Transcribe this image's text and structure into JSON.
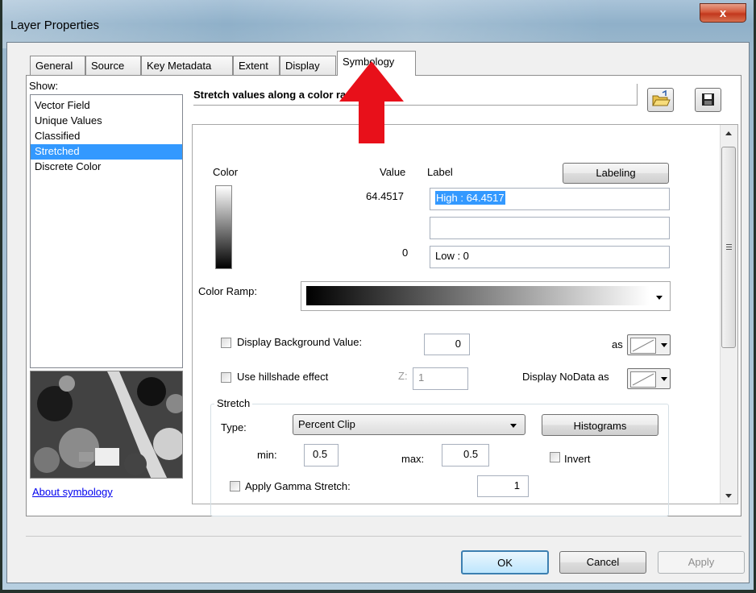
{
  "window": {
    "title": "Layer Properties",
    "close_glyph": "x"
  },
  "tabs": [
    {
      "label": "General"
    },
    {
      "label": "Source"
    },
    {
      "label": "Key Metadata"
    },
    {
      "label": "Extent"
    },
    {
      "label": "Display"
    },
    {
      "label": "Symbology"
    }
  ],
  "active_tab": "Symbology",
  "show": {
    "label": "Show:",
    "items": [
      "Vector Field",
      "Unique Values",
      "Classified",
      "Stretched",
      "Discrete Color"
    ],
    "selected": "Stretched"
  },
  "about_link": "About symbology",
  "panel": {
    "heading": "Stretch values along a color ramp",
    "color_header": "Color",
    "value_header": "Value",
    "label_header": "Label",
    "labeling_button": "Labeling",
    "high_value": "64.4517",
    "high_label": "High : 64.4517",
    "mid_label": "",
    "low_value": "0",
    "low_label": "Low : 0",
    "color_ramp_label": "Color Ramp:",
    "display_background_label": "Display Background Value:",
    "display_background_value": "0",
    "as_label": "as",
    "hillshade_label": "Use hillshade effect",
    "z_label": "Z:",
    "z_value": "1",
    "nodata_label": "Display NoData as",
    "stretch_group_label": "Stretch",
    "type_label": "Type:",
    "type_value": "Percent Clip",
    "histograms_button": "Histograms",
    "min_label": "min:",
    "min_value": "0.5",
    "max_label": "max:",
    "max_value": "0.5",
    "invert_label": "Invert",
    "gamma_label": "Apply Gamma Stretch:",
    "gamma_value": "1"
  },
  "footer": {
    "ok": "OK",
    "cancel": "Cancel",
    "apply": "Apply"
  },
  "colors": {
    "selection": "#3399ff",
    "close_button": "#c2381d",
    "red_arrow": "#e8101a",
    "link": "#0000ee"
  },
  "icons": [
    "close-icon",
    "open-folder-icon",
    "save-disk-icon",
    "dropdown-arrow-icon",
    "scroll-up-icon",
    "scroll-down-icon",
    "red-pointer-arrow"
  ]
}
